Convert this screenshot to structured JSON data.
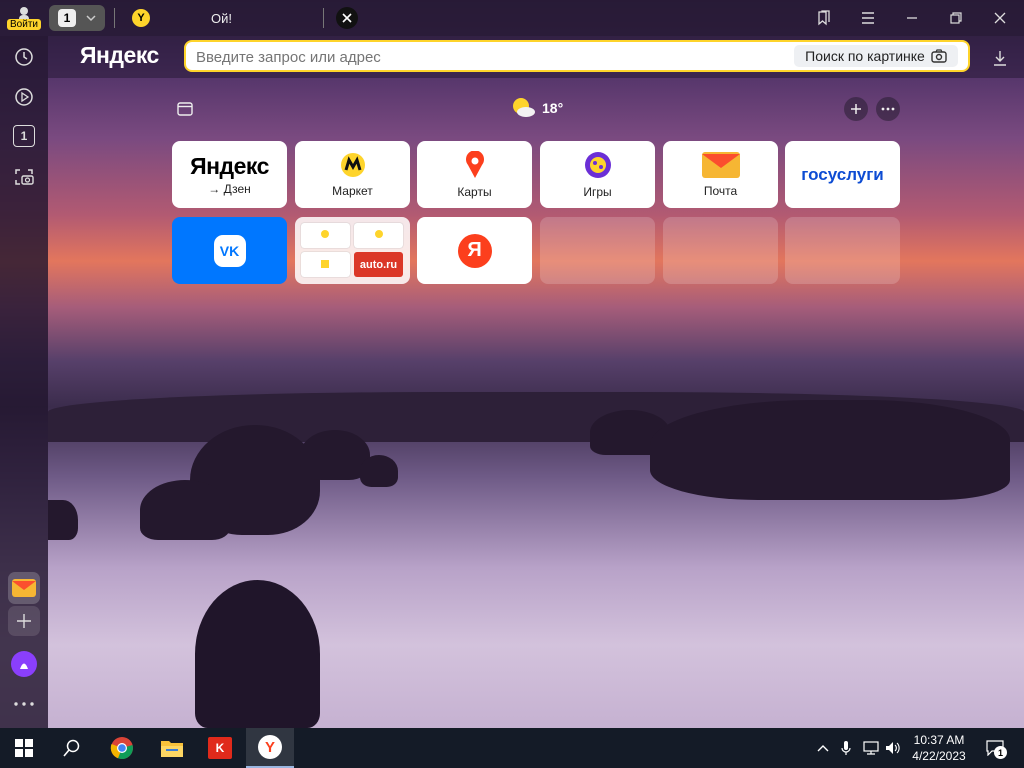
{
  "tabbar": {
    "login_label": "Войти",
    "tab_count": "1",
    "tab_title": "Ой!"
  },
  "brand": {
    "logo_text": "Яндекс"
  },
  "address": {
    "placeholder": "Введите запрос или адрес",
    "image_search_label": "Поиск по картинке"
  },
  "sidebar": {
    "tabs_badge": "1"
  },
  "newtab": {
    "weather_temp": "18°"
  },
  "tiles": [
    {
      "brand": "Яндекс",
      "label": "→ Дзен"
    },
    {
      "label": "Маркет"
    },
    {
      "label": "Карты"
    },
    {
      "label": "Игры"
    },
    {
      "label": "Почта"
    },
    {
      "brand": "госуслуги"
    },
    {
      "brand": "VK"
    },
    {
      "brand": "auto.ru"
    },
    {
      "brand": "Я"
    }
  ],
  "taskbar": {
    "time": "10:37 AM",
    "date": "4/22/2023",
    "notification_count": "1"
  },
  "colors": {
    "accent_yellow": "#fed42b",
    "vk_blue": "#0077ff",
    "yandex_red": "#fc3f1d",
    "gosuslugi_blue": "#0d4cd3"
  }
}
